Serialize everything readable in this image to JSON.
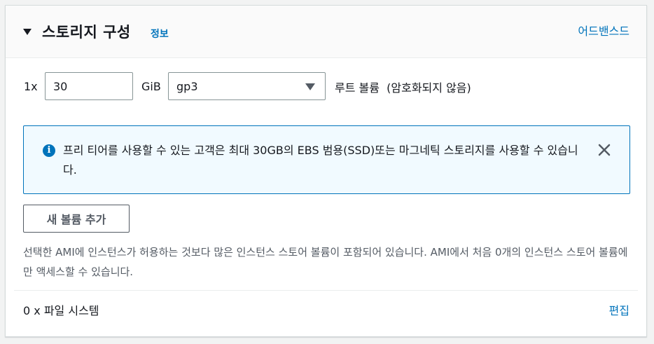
{
  "section": {
    "title": "스토리지 구성",
    "info_link": "정보",
    "advanced_link": "어드밴스드"
  },
  "volume": {
    "count": "1x",
    "size_value": "30",
    "size_unit": "GiB",
    "type_selected": "gp3",
    "root_label": "루트 볼륨  (암호화되지 않음)"
  },
  "alert": {
    "icon": "info-icon",
    "text": "프리 티어를 사용할 수 있는 고객은 최대 30GB의 EBS 범용(SSD)또는 마그네틱 스토리지를 사용할 수 있습니다.",
    "close_icon": "close-icon"
  },
  "add_volume_button": "새 볼륨 추가",
  "description": "선택한 AMI에 인스턴스가 허용하는 것보다 많은 인스턴스 스토어 볼륨이 포함되어 있습니다. AMI에서 처음 0개의 인스턴스 스토어 볼륨에만 액세스할 수 있습니다.",
  "file_systems": {
    "label": "0 x 파일 시스템",
    "edit_link": "편집"
  },
  "colors": {
    "link": "#0073bb",
    "alert_bg": "#f1faff",
    "alert_border": "#0073bb"
  }
}
